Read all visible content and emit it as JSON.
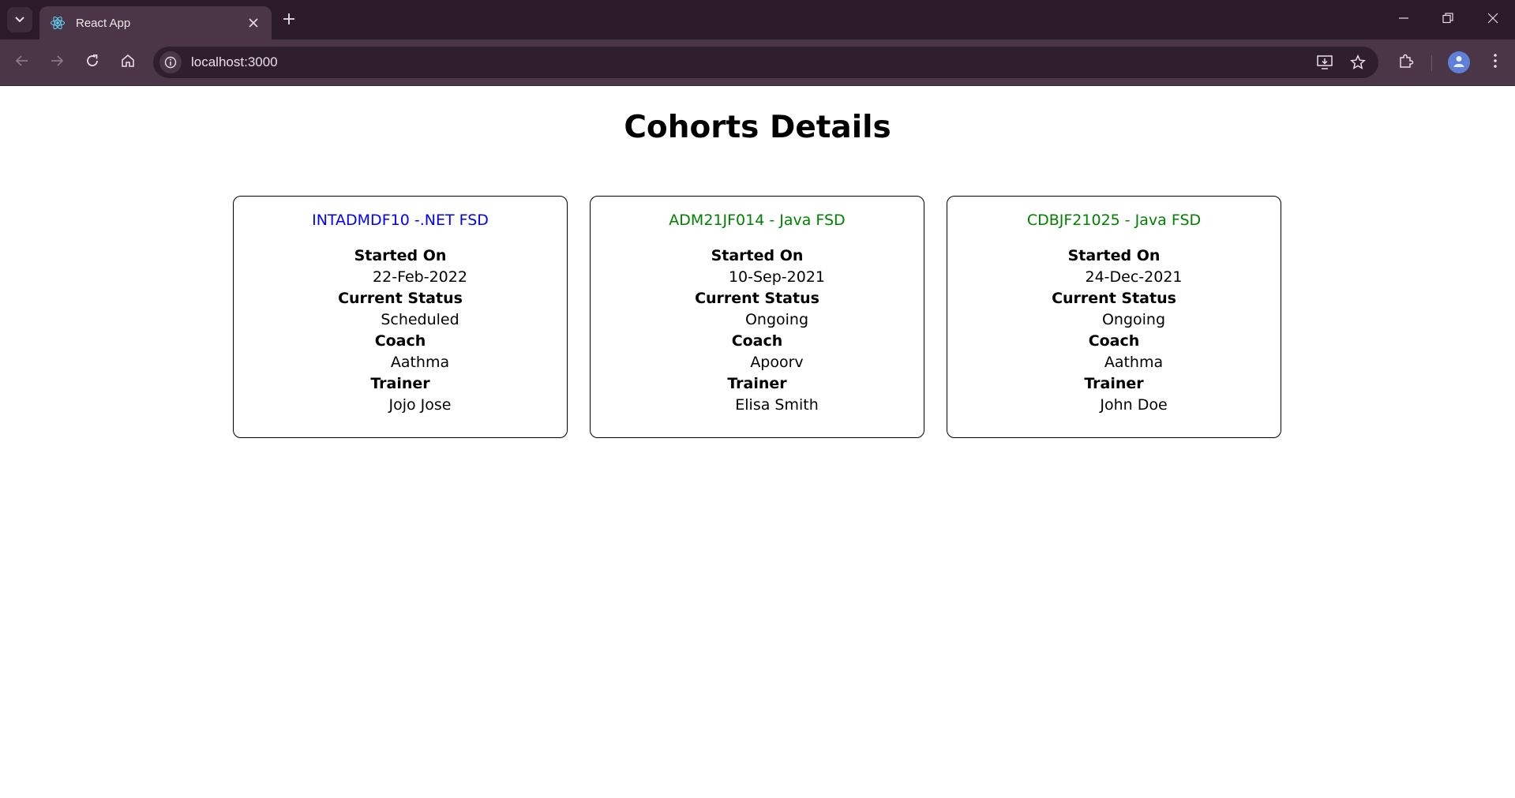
{
  "browser": {
    "tab_title": "React App",
    "url": "localhost:3000"
  },
  "page": {
    "title": "Cohorts Details"
  },
  "labels": {
    "started_on": "Started On",
    "current_status": "Current Status",
    "coach": "Coach",
    "trainer": "Trainer"
  },
  "cohorts": [
    {
      "name": "INTADMDF10 -.NET FSD",
      "name_color": "#0000ff",
      "started_on": "22-Feb-2022",
      "current_status": "Scheduled",
      "coach": "Aathma",
      "trainer": "Jojo Jose"
    },
    {
      "name": "ADM21JF014 - Java FSD",
      "name_color": "#008000",
      "started_on": "10-Sep-2021",
      "current_status": "Ongoing",
      "coach": "Apoorv",
      "trainer": "Elisa Smith"
    },
    {
      "name": "CDBJF21025 - Java FSD",
      "name_color": "#008000",
      "started_on": "24-Dec-2021",
      "current_status": "Ongoing",
      "coach": "Aathma",
      "trainer": "John Doe"
    }
  ]
}
